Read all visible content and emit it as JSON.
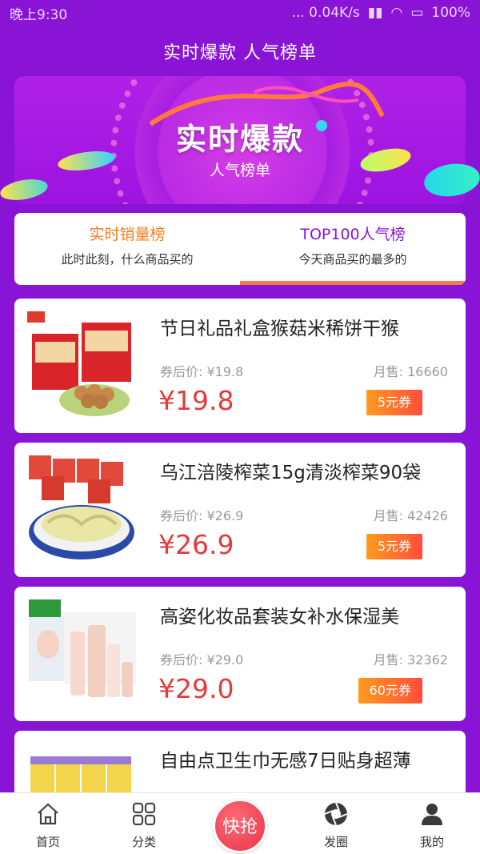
{
  "status": {
    "time": "晚上9:30",
    "network": "... 0.04K/s",
    "battery": "100%"
  },
  "header": {
    "title": "实时爆款 人气榜单"
  },
  "banner": {
    "title": "实时爆款",
    "subtitle": "人气榜单"
  },
  "tabs": [
    {
      "label": "实时销量榜",
      "desc": "此时此刻，什么商品买的"
    },
    {
      "label": "TOP100人气榜",
      "desc": "今天商品买的最多的"
    }
  ],
  "products": [
    {
      "name": "节日礼品礼盒猴菇米稀饼干猴",
      "orig": "券后价: ¥19.8",
      "sold": "月售: 16660",
      "price": "¥19.8",
      "coupon": "5元券",
      "image": "biscuit-gift-box"
    },
    {
      "name": "乌江涪陵榨菜15g清淡榨菜90袋",
      "orig": "券后价: ¥26.9",
      "sold": "月售: 42426",
      "price": "¥26.9",
      "coupon": "5元券",
      "image": "pickled-vegetable"
    },
    {
      "name": "高姿化妆品套装女补水保湿美",
      "orig": "券后价: ¥29.0",
      "sold": "月售: 32362",
      "price": "¥29.0",
      "coupon": "60元券",
      "image": "cosmetics-set"
    },
    {
      "name": "自由点卫生巾无感7日贴身超薄",
      "image": "sanitary-pads"
    }
  ],
  "nav": [
    {
      "label": "首页",
      "icon": "home-icon"
    },
    {
      "label": "分类",
      "icon": "grid-icon"
    },
    {
      "label": "快抢",
      "icon": "flash-sale-button"
    },
    {
      "label": "发圈",
      "icon": "aperture-icon"
    },
    {
      "label": "我的",
      "icon": "user-icon"
    }
  ],
  "colors": {
    "primary": "#8a14d6",
    "price": "#e23b3b",
    "accent": "#f57c1f"
  }
}
